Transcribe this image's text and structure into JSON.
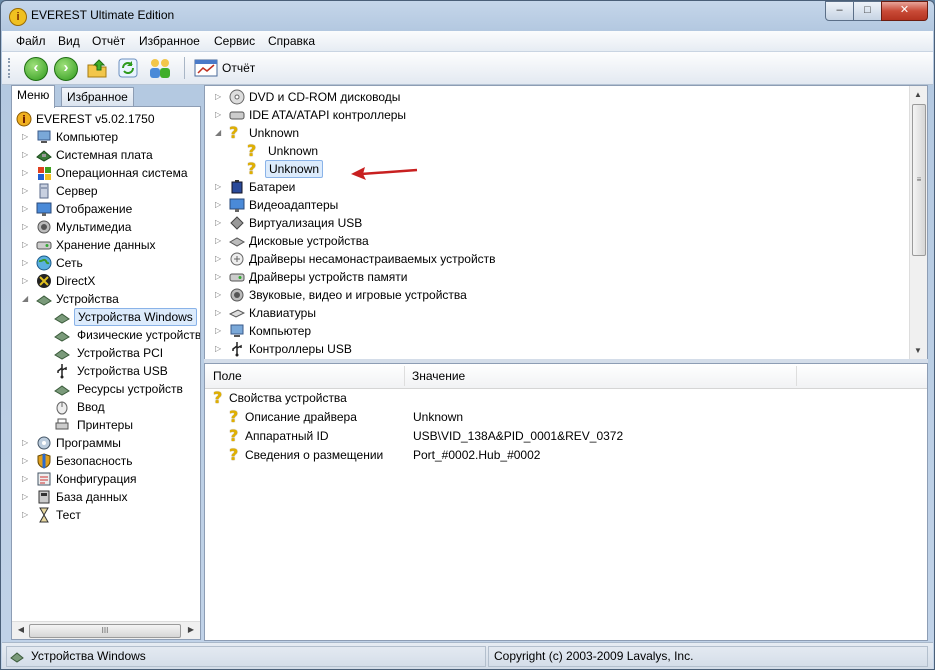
{
  "window": {
    "title": "EVEREST Ultimate Edition",
    "buttons": {
      "minimize": "–",
      "maximize": "□",
      "close": "✕"
    }
  },
  "menu": [
    "Файл",
    "Вид",
    "Отчёт",
    "Избранное",
    "Сервис",
    "Справка"
  ],
  "toolbar": {
    "report_label": "Отчёт"
  },
  "left": {
    "tabs": [
      "Меню",
      "Избранное"
    ],
    "root": "EVEREST v5.02.1750",
    "items": [
      "Компьютер",
      "Системная плата",
      "Операционная система",
      "Сервер",
      "Отображение",
      "Мультимедиа",
      "Хранение данных",
      "Сеть",
      "DirectX",
      "Устройства"
    ],
    "device_children": [
      "Устройства Windows",
      "Физические устройства",
      "Устройства PCI",
      "Устройства USB",
      "Ресурсы устройств",
      "Ввод",
      "Принтеры"
    ],
    "items_after": [
      "Программы",
      "Безопасность",
      "Конфигурация",
      "База данных",
      "Тест"
    ],
    "hscroll_grip": "III"
  },
  "device_tree": [
    "DVD и CD-ROM дисководы",
    "IDE ATA/ATAPI контроллеры",
    "Unknown",
    "Unknown",
    "Unknown",
    "Батареи",
    "Видеоадаптеры",
    "Виртуализация USB",
    "Дисковые устройства",
    "Драйверы несамонастраиваемых устройств",
    "Драйверы устройств памяти",
    "Звуковые, видео и игровые устройства",
    "Клавиатуры",
    "Компьютер",
    "Контроллеры USB"
  ],
  "properties": {
    "columns": [
      "Поле",
      "Значение"
    ],
    "group": "Свойства устройства",
    "rows": [
      {
        "field": "Описание драйвера",
        "value": "Unknown"
      },
      {
        "field": "Аппаратный ID",
        "value": "USB\\VID_138A&PID_0001&REV_0372"
      },
      {
        "field": "Сведения о размещении",
        "value": "Port_#0002.Hub_#0002"
      }
    ]
  },
  "status": {
    "left": "Устройства Windows",
    "right": "Copyright (c) 2003-2009 Lavalys, Inc."
  }
}
